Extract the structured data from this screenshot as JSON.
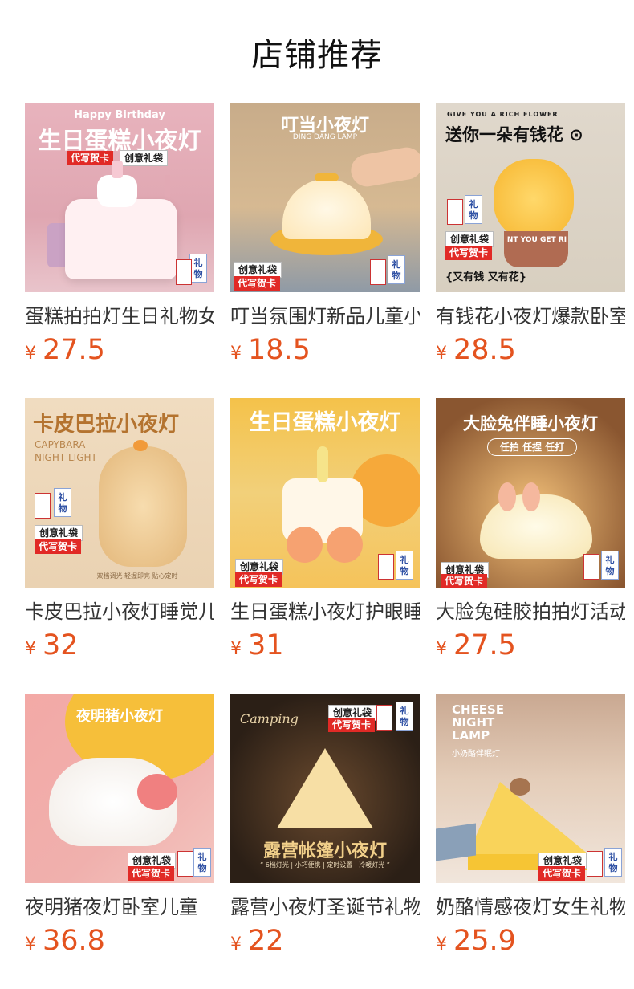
{
  "page": {
    "title": "店铺推荐"
  },
  "products": [
    {
      "name": "蛋糕拍拍灯生日礼物女生",
      "currency": "¥",
      "price": "27.5",
      "image": {
        "subtitle": "Happy Birthday",
        "headline": "生日蛋糕小夜灯",
        "tag_red": "代写贺卡",
        "tag_white": "创意礼袋",
        "bag_text": "礼物"
      }
    },
    {
      "name": "叮当氛围灯新品儿童小夜灯",
      "currency": "¥",
      "price": "18.5",
      "image": {
        "headline": "叮当小夜灯",
        "subtitle": "DING DANG LAMP",
        "tag_white": "创意礼袋",
        "tag_red": "代写贺卡",
        "bag_text": "礼物"
      }
    },
    {
      "name": "有钱花小夜灯爆款卧室",
      "currency": "¥",
      "price": "28.5",
      "image": {
        "subtitle": "GIVE YOU A RICH FLOWER",
        "headline": "送你一朵有钱花 ⊙",
        "tag_white": "创意礼袋",
        "tag_red": "代写贺卡",
        "caption": "{又有钱 又有花}",
        "pot_text": "NT YOU GET RI",
        "bag_text": "礼物"
      }
    },
    {
      "name": "卡皮巴拉小夜灯睡觉儿童",
      "currency": "¥",
      "price": "32",
      "image": {
        "headline": "卡皮巴拉小夜灯",
        "subtitle": "CAPYBARA\nNIGHT LIGHT",
        "tag_white": "创意礼袋",
        "tag_red": "代写贺卡",
        "caption": "双档调光 轻握即亮 贴心定时",
        "bag_text": "礼物"
      }
    },
    {
      "name": "生日蛋糕小夜灯护眼睡眠",
      "currency": "¥",
      "price": "31",
      "image": {
        "headline": "生日蛋糕小夜灯",
        "tag_white": "创意礼袋",
        "tag_red": "代写贺卡",
        "bag_text": "礼物"
      }
    },
    {
      "name": "大脸兔硅胶拍拍灯活动",
      "currency": "¥",
      "price": "27.5",
      "image": {
        "headline": "大脸兔伴睡小夜灯",
        "subtitle": "任拍 任捏 任打",
        "tag_white": "创意礼袋",
        "tag_red": "代写贺卡",
        "bag_text": "礼物"
      }
    },
    {
      "name": "夜明猪夜灯卧室儿童",
      "currency": "¥",
      "price": "36.8",
      "image": {
        "headline": "夜明猪小夜灯",
        "tag_white": "创意礼袋",
        "tag_red": "代写贺卡",
        "bag_text": "礼物"
      }
    },
    {
      "name": "露营小夜灯圣诞节礼物",
      "currency": "¥",
      "price": "22",
      "image": {
        "subtitle": "Camping",
        "headline": "露营帐篷小夜灯",
        "tag_white": "创意礼袋",
        "tag_red": "代写贺卡",
        "caption": "“ 6档灯光 | 小巧便携 | 定时设置 | 冷暖灯光 ”",
        "bag_text": "礼物"
      }
    },
    {
      "name": "奶酪情感夜灯女生礼物",
      "currency": "¥",
      "price": "25.9",
      "image": {
        "headline": "CHEESE\nNIGHT\nLAMP",
        "subtitle": "小奶酪伴眠灯",
        "tag_white": "创意礼袋",
        "tag_red": "代写贺卡",
        "bag_text": "礼物"
      }
    }
  ]
}
